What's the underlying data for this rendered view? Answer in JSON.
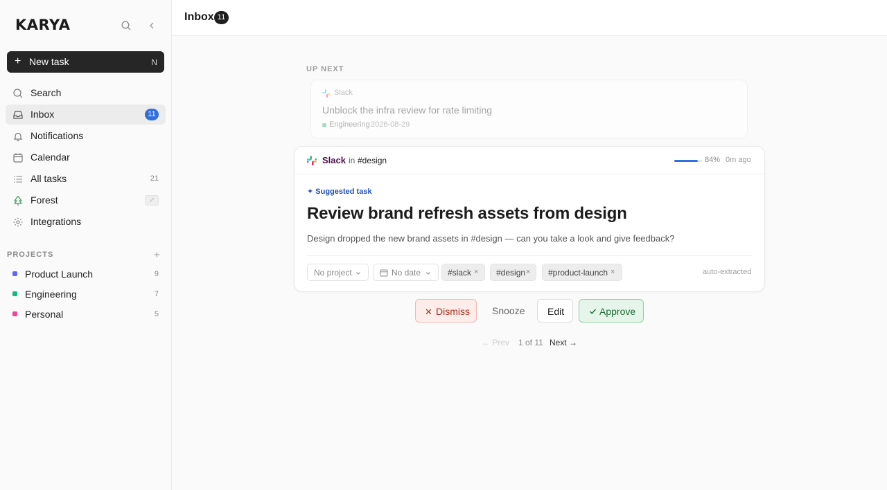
{
  "app": {
    "brand": "KARYA"
  },
  "sidebar": {
    "new_task": {
      "label": "New task",
      "shortcut": "N"
    },
    "nav": [
      {
        "label": "Search"
      },
      {
        "label": "Inbox",
        "count": "11"
      },
      {
        "label": "Notifications"
      },
      {
        "label": "Calendar"
      },
      {
        "label": "All tasks",
        "count": "21"
      },
      {
        "label": "Forest"
      },
      {
        "label": "Integrations"
      }
    ],
    "projects_heading": "PROJECTS",
    "projects_add": "+",
    "projects": [
      {
        "label": "Product Launch",
        "count": "9",
        "color": "#6366f1"
      },
      {
        "label": "Engineering",
        "count": "7",
        "color": "#10b981"
      },
      {
        "label": "Personal",
        "count": "5",
        "color": "#ec4899"
      }
    ]
  },
  "header": {
    "title": "Inbox",
    "count": "11"
  },
  "up_next": {
    "label": "UP NEXT",
    "source": "Slack",
    "title": "Unblock the infra review for rate limiting",
    "project": "Engineering",
    "date": "2026-08-29"
  },
  "card": {
    "source": "Slack",
    "in_label": "in",
    "channel": "#design",
    "confidence": 0.84,
    "confidence_label": "84%",
    "ago": "0m ago",
    "suggested_label": "✦ Suggested task",
    "title": "Review brand refresh assets from design",
    "description": "Design dropped the new brand assets in #design — can you take a look and give feedback?",
    "project_chip": "No project",
    "date_chip": "No date",
    "tags": [
      "#slack",
      "#design",
      "#product-launch"
    ],
    "auto_label": "auto-extracted"
  },
  "actions": {
    "dismiss": "Dismiss",
    "snooze": "Snooze",
    "edit": "Edit",
    "approve": "Approve"
  },
  "pager": {
    "prev": "← Prev",
    "count": "1 of 11",
    "next": "Next →"
  },
  "colors": {
    "accent": "#2f6fe0",
    "slack_purple": "#4a154b",
    "dismiss_text": "#a3321e",
    "approve_text": "#1d6b35"
  }
}
